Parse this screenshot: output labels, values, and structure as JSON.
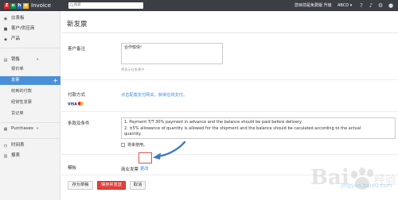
{
  "app": {
    "logo_letters": [
      "Z",
      "o",
      "h",
      "o"
    ],
    "name": "Invoice"
  },
  "topbar": {
    "search_placeholder": "搜索",
    "upgrade_text": "您目前是免费版 升级",
    "org_label": "ABCD ▾"
  },
  "sidebar": {
    "items": [
      {
        "label": "仪表板",
        "icon": "dashboard-icon"
      },
      {
        "label": "客户/供应商",
        "icon": "contacts-icon"
      },
      {
        "label": "产品",
        "icon": "products-icon"
      },
      {
        "label": "销售",
        "icon": "sales-icon"
      },
      {
        "label": "报价单"
      },
      {
        "label": "发票"
      },
      {
        "label": "收到的付款"
      },
      {
        "label": "经常性发票"
      },
      {
        "label": "贷记单"
      },
      {
        "label": "Purchases",
        "icon": "purchases-icon"
      },
      {
        "label": "时间表",
        "icon": "timesheet-icon"
      },
      {
        "label": "报表",
        "icon": "reports-icon"
      }
    ],
    "active_item_plus": "+",
    "collapse_caret": "▾"
  },
  "main": {
    "title": "新发票",
    "customer_notes": {
      "label": "客户备注",
      "value": "合作愉快!",
      "hint": "将显示在发票中"
    },
    "payment": {
      "label": "付款方式",
      "link_text": "点击配置支付网关，获得在线支付。"
    },
    "terms": {
      "label": "条款及条件",
      "lines": [
        "1. Payment T/T 30% payment in advance and the balance should be paid before delivery",
        "2. ±5% allowance of quantity is allowed for the shipment and the balance should be caculated according to the actual",
        "quantity."
      ],
      "checkbox_label": "将来使用。"
    },
    "template": {
      "label": "模板",
      "value": "商业发票",
      "change_link": "更改"
    },
    "buttons": {
      "save_draft": "存为草稿",
      "save_send": "保存并发送",
      "cancel": "取消"
    }
  },
  "watermark": {
    "text": "jingyan.baidu.com"
  },
  "colors": {
    "topbar_bg": "#3b3e44",
    "sidebar_bg": "#f3f3f3",
    "active_item": "#4a90d9",
    "primary_button": "#e1413a",
    "link": "#3b8ad9",
    "annotation_arrow": "#3a78c4"
  }
}
